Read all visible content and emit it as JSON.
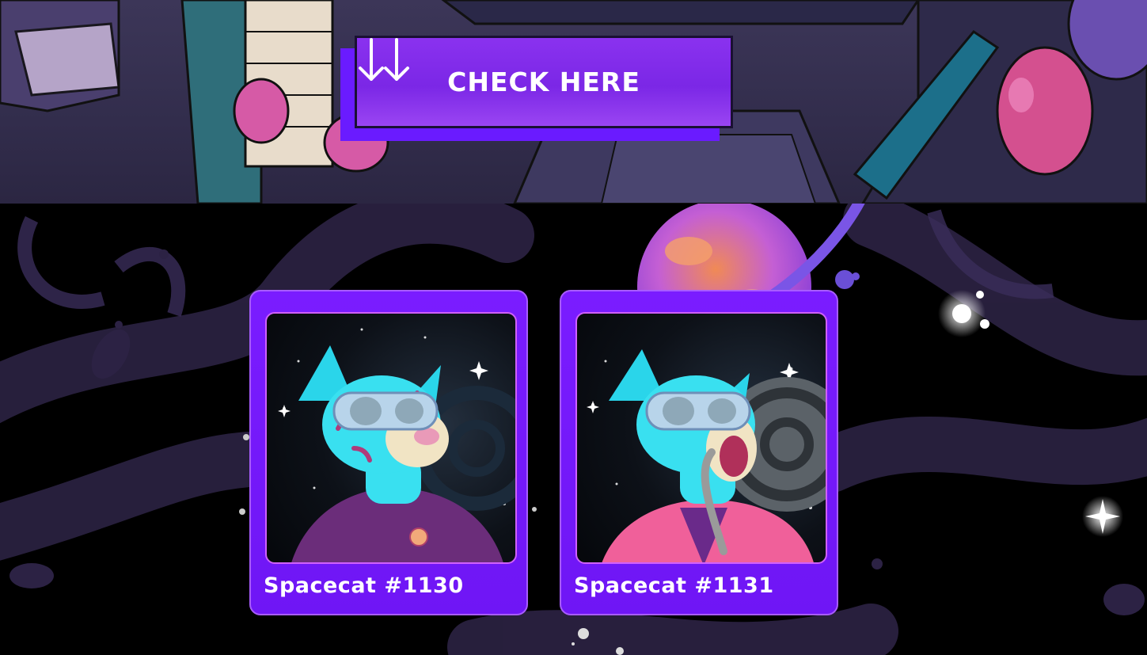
{
  "cta": {
    "label": "CHECK HERE",
    "left_icon": "arrow-down-icon",
    "right_icon": "arrow-down-icon"
  },
  "cards": [
    {
      "name": "Spacecat #1130",
      "image_icon": "spacecat-nft-image"
    },
    {
      "name": "Spacecat #1131",
      "image_icon": "spacecat-nft-image"
    }
  ],
  "colors": {
    "accent": "#7a1cff",
    "cta_shadow": "#6a1bff",
    "hero_bg": "#3c3658",
    "space_bg": "#000000",
    "swirl": "#2a2140"
  }
}
